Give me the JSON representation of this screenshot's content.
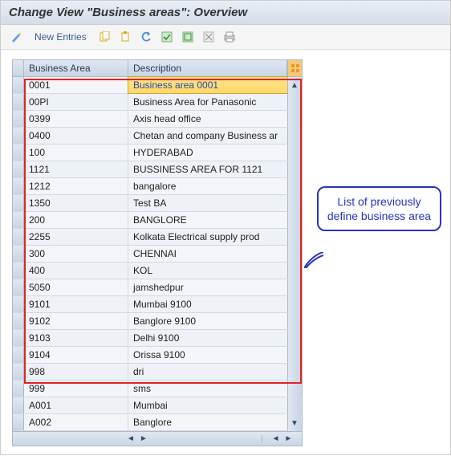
{
  "title": "Change View \"Business areas\": Overview",
  "toolbar": {
    "new_entries": "New Entries"
  },
  "headers": {
    "code": "Business Area",
    "desc": "Description"
  },
  "callout": "List of previously define business area",
  "rows": [
    {
      "code": "0001",
      "desc": "Business area 0001",
      "selected": true
    },
    {
      "code": "00PI",
      "desc": "Business Area for Panasonic"
    },
    {
      "code": "0399",
      "desc": "Axis head office"
    },
    {
      "code": "0400",
      "desc": "Chetan and company Business ar"
    },
    {
      "code": "100",
      "desc": "HYDERABAD"
    },
    {
      "code": "1121",
      "desc": "BUSSINESS AREA FOR 1121"
    },
    {
      "code": "1212",
      "desc": "bangalore"
    },
    {
      "code": "1350",
      "desc": "Test BA"
    },
    {
      "code": "200",
      "desc": "BANGLORE"
    },
    {
      "code": "2255",
      "desc": "Kolkata Electrical supply prod"
    },
    {
      "code": "300",
      "desc": "CHENNAI"
    },
    {
      "code": "400",
      "desc": "KOL"
    },
    {
      "code": "5050",
      "desc": "jamshedpur"
    },
    {
      "code": "9101",
      "desc": "Mumbai  9100"
    },
    {
      "code": "9102",
      "desc": "Banglore  9100"
    },
    {
      "code": "9103",
      "desc": "Delhi   9100"
    },
    {
      "code": "9104",
      "desc": "Orissa 9100"
    },
    {
      "code": "998",
      "desc": "dri"
    },
    {
      "code": "999",
      "desc": "sms"
    },
    {
      "code": "A001",
      "desc": "Mumbai"
    },
    {
      "code": "A002",
      "desc": "Banglore"
    }
  ],
  "icons": {
    "wand": "#6aa0e2",
    "copy": "#d8a325",
    "paste": "#d8a325",
    "undo": "#4d8fd6",
    "sel_all": "#6fb26f",
    "sel_block": "#6fb26f",
    "desel": "#b0b0b0",
    "print": "#9f9f9f",
    "grid": "#e09a2f"
  }
}
